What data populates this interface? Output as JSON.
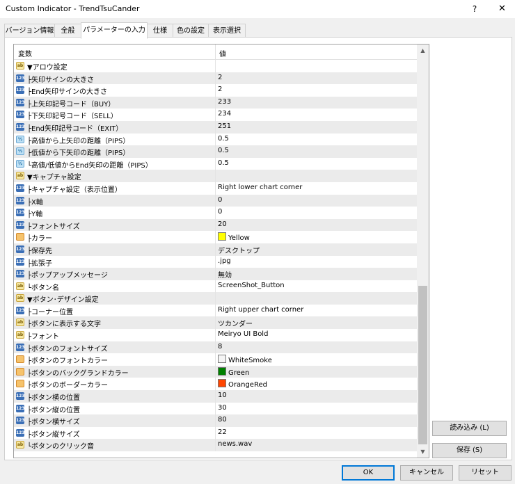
{
  "window": {
    "title": "Custom Indicator - TrendTsuCander",
    "help": "?",
    "close": "✕"
  },
  "tabs": [
    {
      "label": "バージョン情報"
    },
    {
      "label": "全般"
    },
    {
      "label": "パラメーターの入力"
    },
    {
      "label": "仕様"
    },
    {
      "label": "色の設定"
    },
    {
      "label": "表示選択"
    }
  ],
  "active_tab": "パラメーターの入力",
  "grid": {
    "col_variable": "変数",
    "col_value": "値",
    "rows": [
      {
        "icon": "ab",
        "name": "▼アロウ設定",
        "value": ""
      },
      {
        "icon": "123",
        "name": "├矢印サインの大きさ",
        "value": "2"
      },
      {
        "icon": "123",
        "name": "├End矢印サインの大きさ",
        "value": "2"
      },
      {
        "icon": "123",
        "name": "├上矢印記号コード（BUY）",
        "value": "233"
      },
      {
        "icon": "123",
        "name": "├下矢印記号コード（SELL）",
        "value": "234"
      },
      {
        "icon": "123",
        "name": "├End矢印記号コード（EXIT）",
        "value": "251"
      },
      {
        "icon": "½",
        "name": "├高値から上矢印の距離（PIPS）",
        "value": "0.5"
      },
      {
        "icon": "½",
        "name": "├低値から下矢印の距離（PIPS）",
        "value": "0.5"
      },
      {
        "icon": "½",
        "name": "└高値/低値からEnd矢印の距離（PIPS）",
        "value": "0.5"
      },
      {
        "icon": "ab",
        "name": "▼キャプチャ設定",
        "value": ""
      },
      {
        "icon": "123",
        "name": "├キャプチャ設定（表示位置）",
        "value": "Right lower chart corner"
      },
      {
        "icon": "123",
        "name": "├X軸",
        "value": "0"
      },
      {
        "icon": "123",
        "name": "├Y軸",
        "value": "0"
      },
      {
        "icon": "123",
        "name": "├フォントサイズ",
        "value": "20"
      },
      {
        "icon": "color",
        "name": "├カラー",
        "value": "Yellow",
        "color": "#ffff00"
      },
      {
        "icon": "123",
        "name": "├保存先",
        "value": "デスクトップ"
      },
      {
        "icon": "123",
        "name": "├拡張子",
        "value": ".jpg"
      },
      {
        "icon": "123",
        "name": "├ポップアップメッセージ",
        "value": "無効"
      },
      {
        "icon": "ab",
        "name": "└ボタン名",
        "value": "ScreenShot_Button"
      },
      {
        "icon": "ab",
        "name": "▼ボタン･デザイン設定",
        "value": ""
      },
      {
        "icon": "123",
        "name": "├コーナー位置",
        "value": "Right upper chart corner"
      },
      {
        "icon": "ab",
        "name": "├ボタンに表示する文字",
        "value": "ツカンダー"
      },
      {
        "icon": "ab",
        "name": "├フォント",
        "value": "Meiryo UI Bold"
      },
      {
        "icon": "123",
        "name": "├ボタンのフォントサイズ",
        "value": "8"
      },
      {
        "icon": "color",
        "name": "├ボタンのフォントカラー",
        "value": "WhiteSmoke",
        "color": "#f5f5f5"
      },
      {
        "icon": "color",
        "name": "├ボタンのバックグランドカラー",
        "value": "Green",
        "color": "#008000"
      },
      {
        "icon": "color",
        "name": "├ボタンのボーダーカラー",
        "value": "OrangeRed",
        "color": "#ff4500"
      },
      {
        "icon": "123",
        "name": "├ボタン横の位置",
        "value": "10"
      },
      {
        "icon": "123",
        "name": "├ボタン縦の位置",
        "value": "30"
      },
      {
        "icon": "123",
        "name": "├ボタン横サイズ",
        "value": "80"
      },
      {
        "icon": "123",
        "name": "├ボタン縦サイズ",
        "value": "22"
      },
      {
        "icon": "ab",
        "name": "└ボタンのクリック音",
        "value": "news.wav"
      }
    ]
  },
  "side_buttons": {
    "load": "読み込み (L)",
    "save": "保存 (S)"
  },
  "footer": {
    "ok": "OK",
    "cancel": "キャンセル",
    "reset": "リセット"
  }
}
